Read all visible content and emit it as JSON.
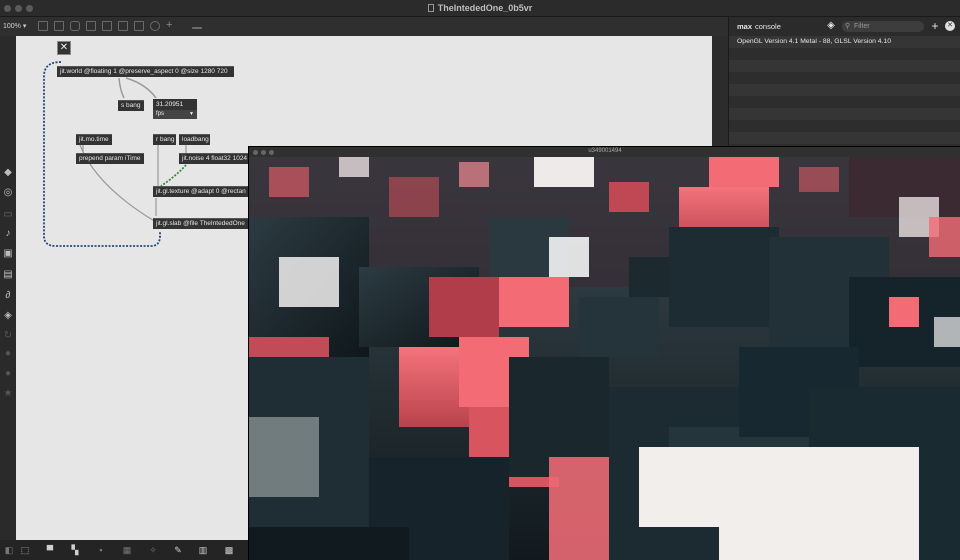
{
  "window": {
    "title": "TheIntededOne_0b5vr"
  },
  "toolbar": {
    "zoom": "100%",
    "zoom_arrow": "▾"
  },
  "patcher": {
    "close_glyph": "✕",
    "objects": {
      "world": "jit.world @floating 1 @preserve_aspect 0 @size 1280 720",
      "s_bang": "s bang",
      "fps_value": "31.20951",
      "fps_menu": "fps",
      "mo_time": "jit.mo.time",
      "prepend": "prepend param iTime",
      "r_bang": "r bang",
      "loadbang": "loadbang",
      "noise": "jit.noise 4 float32 1024",
      "texture": "jit.gl.texture @adapt 0 @rectan",
      "slab": "jit.gl.slab @file TheIntededOne"
    }
  },
  "console": {
    "title_bold": "max",
    "title": "console",
    "filter_placeholder": "Filter",
    "add_glyph": "+",
    "clear_glyph": "✕",
    "messages": [
      "OpenGL Version 4.1 Metal - 88, GLSL Version 4.10"
    ]
  },
  "render_window": {
    "title": "u349001494"
  },
  "colors": {
    "accent_red": "#f0606b",
    "dark_block": "#1c2c33"
  }
}
